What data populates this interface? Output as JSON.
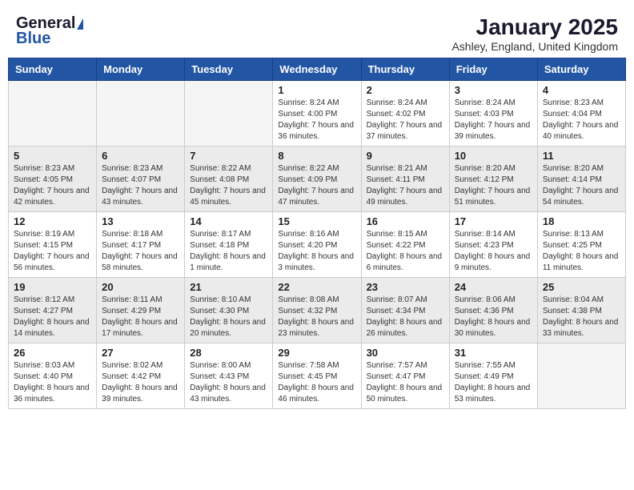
{
  "header": {
    "logo_line1": "General",
    "logo_line2": "Blue",
    "month": "January 2025",
    "location": "Ashley, England, United Kingdom"
  },
  "weekdays": [
    "Sunday",
    "Monday",
    "Tuesday",
    "Wednesday",
    "Thursday",
    "Friday",
    "Saturday"
  ],
  "weeks": [
    [
      {
        "day": "",
        "info": ""
      },
      {
        "day": "",
        "info": ""
      },
      {
        "day": "",
        "info": ""
      },
      {
        "day": "1",
        "info": "Sunrise: 8:24 AM\nSunset: 4:00 PM\nDaylight: 7 hours and 36 minutes."
      },
      {
        "day": "2",
        "info": "Sunrise: 8:24 AM\nSunset: 4:02 PM\nDaylight: 7 hours and 37 minutes."
      },
      {
        "day": "3",
        "info": "Sunrise: 8:24 AM\nSunset: 4:03 PM\nDaylight: 7 hours and 39 minutes."
      },
      {
        "day": "4",
        "info": "Sunrise: 8:23 AM\nSunset: 4:04 PM\nDaylight: 7 hours and 40 minutes."
      }
    ],
    [
      {
        "day": "5",
        "info": "Sunrise: 8:23 AM\nSunset: 4:05 PM\nDaylight: 7 hours and 42 minutes."
      },
      {
        "day": "6",
        "info": "Sunrise: 8:23 AM\nSunset: 4:07 PM\nDaylight: 7 hours and 43 minutes."
      },
      {
        "day": "7",
        "info": "Sunrise: 8:22 AM\nSunset: 4:08 PM\nDaylight: 7 hours and 45 minutes."
      },
      {
        "day": "8",
        "info": "Sunrise: 8:22 AM\nSunset: 4:09 PM\nDaylight: 7 hours and 47 minutes."
      },
      {
        "day": "9",
        "info": "Sunrise: 8:21 AM\nSunset: 4:11 PM\nDaylight: 7 hours and 49 minutes."
      },
      {
        "day": "10",
        "info": "Sunrise: 8:20 AM\nSunset: 4:12 PM\nDaylight: 7 hours and 51 minutes."
      },
      {
        "day": "11",
        "info": "Sunrise: 8:20 AM\nSunset: 4:14 PM\nDaylight: 7 hours and 54 minutes."
      }
    ],
    [
      {
        "day": "12",
        "info": "Sunrise: 8:19 AM\nSunset: 4:15 PM\nDaylight: 7 hours and 56 minutes."
      },
      {
        "day": "13",
        "info": "Sunrise: 8:18 AM\nSunset: 4:17 PM\nDaylight: 7 hours and 58 minutes."
      },
      {
        "day": "14",
        "info": "Sunrise: 8:17 AM\nSunset: 4:18 PM\nDaylight: 8 hours and 1 minute."
      },
      {
        "day": "15",
        "info": "Sunrise: 8:16 AM\nSunset: 4:20 PM\nDaylight: 8 hours and 3 minutes."
      },
      {
        "day": "16",
        "info": "Sunrise: 8:15 AM\nSunset: 4:22 PM\nDaylight: 8 hours and 6 minutes."
      },
      {
        "day": "17",
        "info": "Sunrise: 8:14 AM\nSunset: 4:23 PM\nDaylight: 8 hours and 9 minutes."
      },
      {
        "day": "18",
        "info": "Sunrise: 8:13 AM\nSunset: 4:25 PM\nDaylight: 8 hours and 11 minutes."
      }
    ],
    [
      {
        "day": "19",
        "info": "Sunrise: 8:12 AM\nSunset: 4:27 PM\nDaylight: 8 hours and 14 minutes."
      },
      {
        "day": "20",
        "info": "Sunrise: 8:11 AM\nSunset: 4:29 PM\nDaylight: 8 hours and 17 minutes."
      },
      {
        "day": "21",
        "info": "Sunrise: 8:10 AM\nSunset: 4:30 PM\nDaylight: 8 hours and 20 minutes."
      },
      {
        "day": "22",
        "info": "Sunrise: 8:08 AM\nSunset: 4:32 PM\nDaylight: 8 hours and 23 minutes."
      },
      {
        "day": "23",
        "info": "Sunrise: 8:07 AM\nSunset: 4:34 PM\nDaylight: 8 hours and 26 minutes."
      },
      {
        "day": "24",
        "info": "Sunrise: 8:06 AM\nSunset: 4:36 PM\nDaylight: 8 hours and 30 minutes."
      },
      {
        "day": "25",
        "info": "Sunrise: 8:04 AM\nSunset: 4:38 PM\nDaylight: 8 hours and 33 minutes."
      }
    ],
    [
      {
        "day": "26",
        "info": "Sunrise: 8:03 AM\nSunset: 4:40 PM\nDaylight: 8 hours and 36 minutes."
      },
      {
        "day": "27",
        "info": "Sunrise: 8:02 AM\nSunset: 4:42 PM\nDaylight: 8 hours and 39 minutes."
      },
      {
        "day": "28",
        "info": "Sunrise: 8:00 AM\nSunset: 4:43 PM\nDaylight: 8 hours and 43 minutes."
      },
      {
        "day": "29",
        "info": "Sunrise: 7:58 AM\nSunset: 4:45 PM\nDaylight: 8 hours and 46 minutes."
      },
      {
        "day": "30",
        "info": "Sunrise: 7:57 AM\nSunset: 4:47 PM\nDaylight: 8 hours and 50 minutes."
      },
      {
        "day": "31",
        "info": "Sunrise: 7:55 AM\nSunset: 4:49 PM\nDaylight: 8 hours and 53 minutes."
      },
      {
        "day": "",
        "info": ""
      }
    ]
  ]
}
